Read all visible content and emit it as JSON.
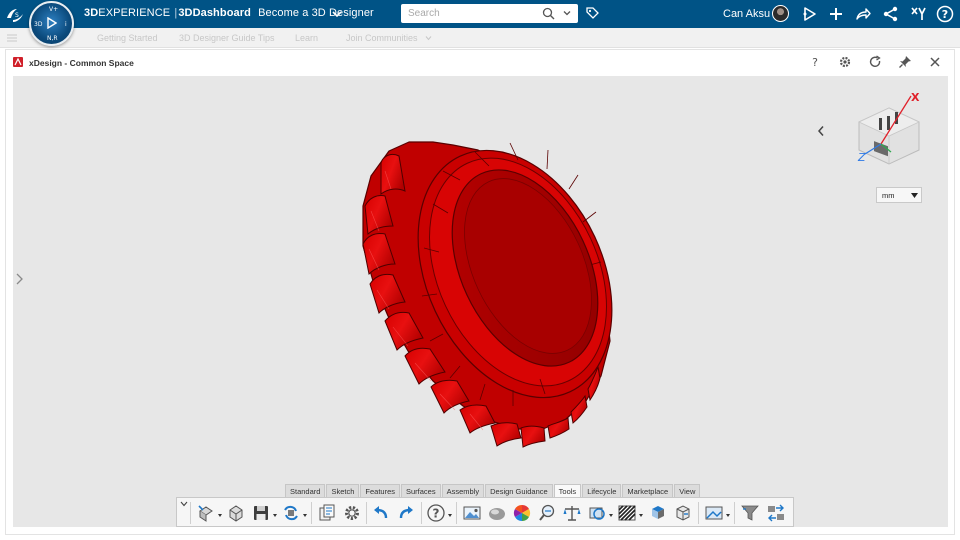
{
  "topbar": {
    "brand_3d": "3D",
    "brand_rest": "EXPERIENCE",
    "separator": "|",
    "app": "3DDashboard",
    "context": "Become a 3D Designer",
    "compass": {
      "top": "V+",
      "left": "3D",
      "right": "i",
      "bottom": "N,R"
    },
    "search_placeholder": "Search",
    "user_name": "Can Aksu",
    "icons": [
      "ds-logo-icon",
      "chevron-down-icon",
      "search-icon",
      "tag-icon",
      "share-play-icon",
      "plus-icon",
      "forward-icon",
      "network-share-icon",
      "tools-icon",
      "help-icon"
    ]
  },
  "tabbar": {
    "tabs": [
      "Getting Started",
      "3D Designer Guide Tips",
      "Learn",
      "Join Communities"
    ]
  },
  "widget": {
    "title": "xDesign - Common Space",
    "icons": [
      "help-icon",
      "gear-icon",
      "refresh-icon",
      "pin-icon",
      "close-icon"
    ]
  },
  "viewport": {
    "model": "bottle-cap",
    "model_color": "#d40000",
    "background": "#e7e7e7",
    "units_value": "mm",
    "axes": {
      "x": "X",
      "z": "Z"
    }
  },
  "actionbar": {
    "tabs": [
      "Standard",
      "Sketch",
      "Features",
      "Surfaces",
      "Assembly",
      "Design Guidance",
      "Tools",
      "Lifecycle",
      "Marketplace",
      "View"
    ],
    "active_tab": "Tools",
    "tools": [
      "insert-part-icon",
      "open-part-icon",
      "save-icon",
      "refresh-sync-icon",
      "properties-icon",
      "settings-gear-icon",
      "undo-icon",
      "redo-icon",
      "help-icon",
      "image-capture-icon",
      "material-icon",
      "appearance-color-icon",
      "analysis-icon",
      "measure-balance-icon",
      "section-icon",
      "zebra-icon",
      "structure-icon",
      "mass-icon",
      "capture-icon",
      "filter-icon",
      "transfer-icon"
    ]
  },
  "colors": {
    "topbar": "#005386",
    "accent_red": "#d40000",
    "undo_blue": "#1f78c8"
  }
}
